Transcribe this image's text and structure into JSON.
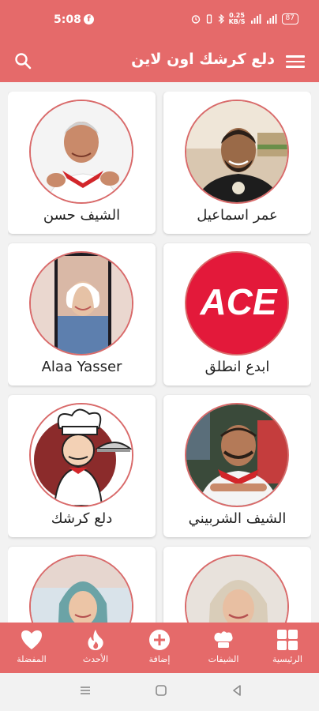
{
  "status": {
    "time": "5:08",
    "fb": "f",
    "speed_value": "0.25",
    "speed_unit": "KB/S",
    "battery": "87"
  },
  "app": {
    "title": "دلع كرشك اون لاين"
  },
  "cards": [
    {
      "name": "عمر اسماعيل"
    },
    {
      "name": "الشيف حسن"
    },
    {
      "name": "ابدع انطلق",
      "logo_text": "ACE"
    },
    {
      "name": "Alaa Yasser"
    },
    {
      "name": "الشيف الشربيني"
    },
    {
      "name": "دلع كرشك"
    },
    {
      "name": ""
    },
    {
      "name": ""
    }
  ],
  "nav": {
    "home": "الرئيسية",
    "chefs": "الشيفات",
    "add": "إضافة",
    "latest": "الأحدث",
    "favorites": "المفضلة"
  },
  "colors": {
    "primary": "#e56a6a",
    "ace_red": "#e3193a"
  }
}
